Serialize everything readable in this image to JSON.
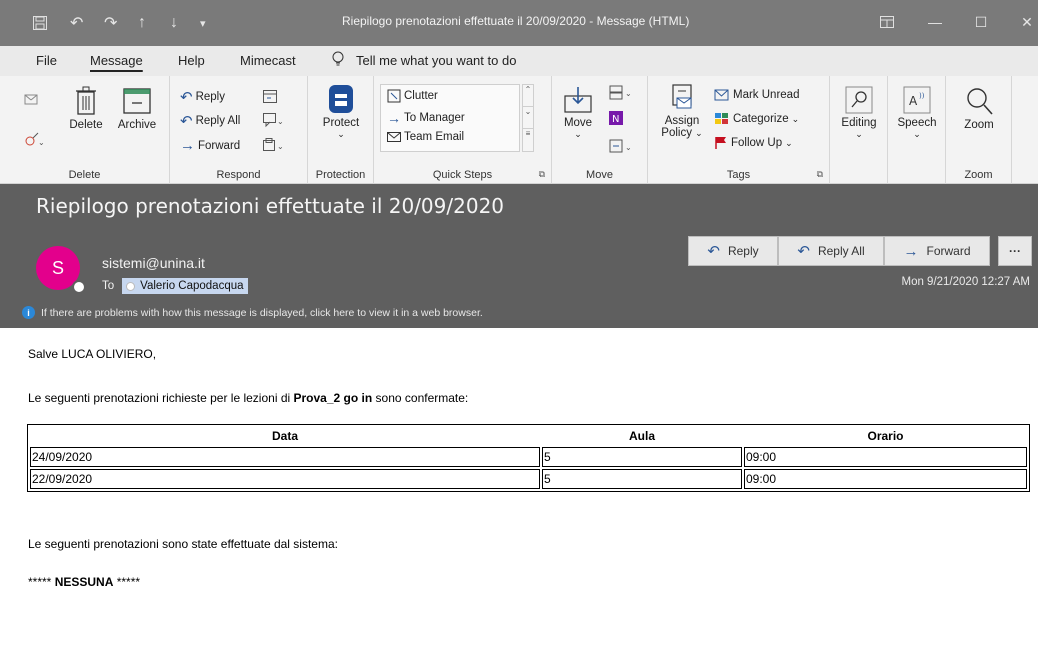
{
  "window": {
    "title": "Riepilogo prenotazioni effettuate il 20/09/2020  -  Message (HTML)",
    "quick_access_icons": [
      "save-icon",
      "undo-icon",
      "redo-icon",
      "up-arrow-icon",
      "down-arrow-icon",
      "customize-icon"
    ],
    "controls": [
      "restore-ribbon-icon",
      "minimize-icon",
      "maximize-icon",
      "close-icon"
    ]
  },
  "menu": {
    "tabs": [
      "File",
      "Message",
      "Help",
      "Mimecast"
    ],
    "active": "Message",
    "tell_me": "Tell me what you want to do"
  },
  "ribbon": {
    "delete": {
      "delete_label": "Delete",
      "archive_label": "Archive",
      "group_label": "Delete"
    },
    "respond": {
      "reply": "Reply",
      "reply_all": "Reply All",
      "forward": "Forward",
      "group_label": "Respond"
    },
    "protection": {
      "protect": "Protect",
      "group_label": "Protection"
    },
    "quick_steps": {
      "items": [
        "Clutter",
        "To Manager",
        "Team Email"
      ],
      "group_label": "Quick Steps"
    },
    "move": {
      "move": "Move",
      "group_label": "Move"
    },
    "tags": {
      "assign_policy_1": "Assign",
      "assign_policy_2": "Policy",
      "mark_unread": "Mark Unread",
      "categorize": "Categorize",
      "follow_up": "Follow Up",
      "group_label": "Tags"
    },
    "editing": {
      "label": "Editing"
    },
    "speech": {
      "label": "Speech"
    },
    "zoom": {
      "label": "Zoom",
      "group_label": "Zoom"
    }
  },
  "message": {
    "subject": "Riepilogo prenotazioni effettuate il 20/09/2020",
    "avatar_initial": "S",
    "sender": "sistemi@unina.it",
    "to_label": "To",
    "recipient": "Valerio Capodacqua",
    "info_bar": "If there are problems with how this message is displayed, click here to view it in a web browser.",
    "actions": {
      "reply": "Reply",
      "reply_all": "Reply All",
      "forward": "Forward",
      "more": "···"
    },
    "datetime": "Mon 9/21/2020 12:27 AM",
    "colors": {
      "avatar": "#e3008c",
      "header_bg": "#5f5f5f",
      "accent": "#2b5797"
    }
  },
  "body": {
    "greeting": "Salve LUCA OLIVIERO,",
    "intro_before": "Le seguenti prenotazioni richieste per le lezioni di ",
    "intro_bold": "Prova_2 go in",
    "intro_after": " sono confermate:",
    "table": {
      "headers": [
        "Data",
        "Aula",
        "Orario"
      ],
      "rows": [
        [
          "24/09/2020",
          "5",
          "09:00"
        ],
        [
          "22/09/2020",
          "5",
          "09:00"
        ]
      ]
    },
    "system_line": "Le seguenti prenotazioni sono state effettuate dal sistema:",
    "none_prefix": "***** ",
    "none_bold": "NESSUNA",
    "none_suffix": " *****"
  }
}
